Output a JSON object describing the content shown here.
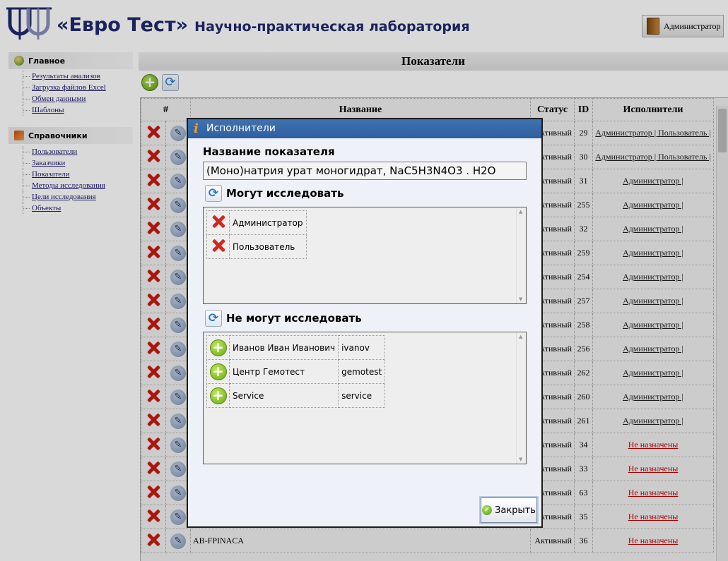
{
  "header": {
    "brand": "«Евро Тест»",
    "subtitle": "Научно-практическая лаборатория",
    "user_button": "Администратор",
    "logo_icon": "lab-logo-icon",
    "user_icon": "door-icon"
  },
  "sidebar": {
    "groups": [
      {
        "title": "Главное",
        "icon": "globe-icon",
        "items": [
          "Результаты анализов",
          "Загрузка файлов Excel",
          "Обмен данными",
          "Шаблоны"
        ]
      },
      {
        "title": "Справочники",
        "icon": "tools-icon",
        "items": [
          "Пользователи",
          "Заказчики",
          "Показатели",
          "Методы исследования",
          "Цели исследования",
          "Объекты"
        ]
      }
    ]
  },
  "main": {
    "title": "Показатели",
    "columns": [
      "#",
      "Название",
      "Статус",
      "ID",
      "Исполнители"
    ],
    "rows": [
      {
        "name": "",
        "status": "Активный",
        "id": "29",
        "executors": "Администратор | Пользователь |"
      },
      {
        "name": "",
        "status": "Активный",
        "id": "30",
        "executors": "Администратор | Пользователь |"
      },
      {
        "name": "",
        "status": "Активный",
        "id": "31",
        "executors": "Администратор |"
      },
      {
        "name": "",
        "status": "Активный",
        "id": "255",
        "executors": "Администратор |"
      },
      {
        "name": "",
        "status": "Активный",
        "id": "32",
        "executors": "Администратор |"
      },
      {
        "name": "",
        "status": "Активный",
        "id": "259",
        "executors": "Администратор |"
      },
      {
        "name": "",
        "status": "Активный",
        "id": "254",
        "executors": "Администратор |"
      },
      {
        "name": "",
        "status": "Активный",
        "id": "257",
        "executors": "Администратор |"
      },
      {
        "name": "",
        "status": "Активный",
        "id": "258",
        "executors": "Администратор |"
      },
      {
        "name": "",
        "status": "Активный",
        "id": "256",
        "executors": "Администратор |"
      },
      {
        "name": "",
        "status": "Активный",
        "id": "262",
        "executors": "Администратор |"
      },
      {
        "name": "",
        "status": "Активный",
        "id": "260",
        "executors": "Администратор |"
      },
      {
        "name": "",
        "status": "Активный",
        "id": "261",
        "executors": "Администратор |"
      },
      {
        "name": "",
        "status": "Активный",
        "id": "34",
        "executors": "Не назначены"
      },
      {
        "name": "",
        "status": "Активный",
        "id": "33",
        "executors": "Не назначены"
      },
      {
        "name": "",
        "status": "Активный",
        "id": "63",
        "executors": "Не назначены"
      },
      {
        "name": "",
        "status": "Активный",
        "id": "35",
        "executors": "Не назначены"
      },
      {
        "name": "AB-FPINACA",
        "status": "Активный",
        "id": "36",
        "executors": "Не назначены"
      }
    ]
  },
  "dialog": {
    "title": "Исполнители",
    "name_label": "Название показателя",
    "name_value": "(Моно)натрия урат моногидрат, NaC5H3N4O3 . H2O",
    "can_label": "Могут исследовать",
    "can_list": [
      "Администратор",
      "Пользователь"
    ],
    "cannot_label": "Не могут исследовать",
    "cannot_list": [
      {
        "name": "Иванов Иван Иванович",
        "login": "ivanov"
      },
      {
        "name": "Центр Гемотест",
        "login": "gemotest"
      },
      {
        "name": "Service",
        "login": "service"
      }
    ],
    "close_label": "Закрыть"
  }
}
